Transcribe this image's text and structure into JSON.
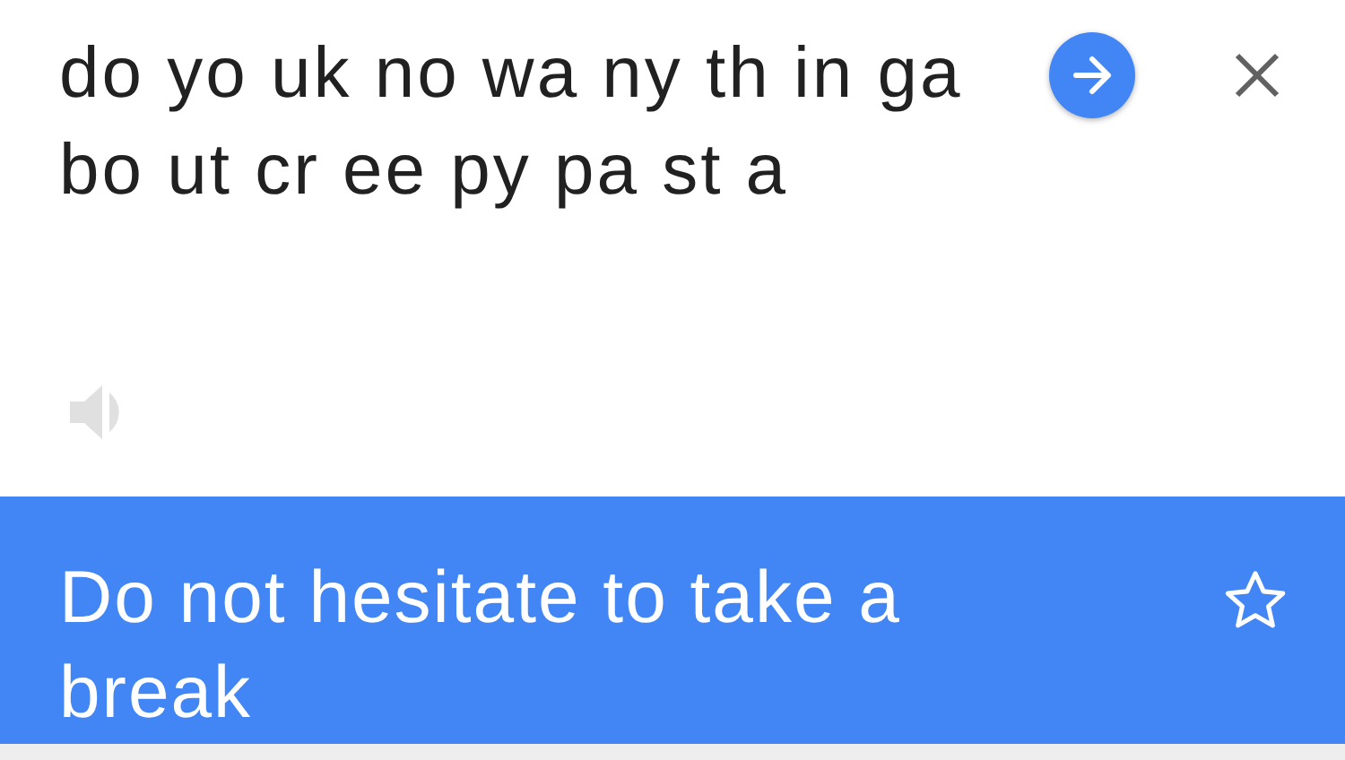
{
  "input": {
    "text": "do yo uk no wa ny th in ga bo ut cr ee py pa st a"
  },
  "translation": {
    "text": "Do not hesitate to take a break",
    "starred": false
  }
}
